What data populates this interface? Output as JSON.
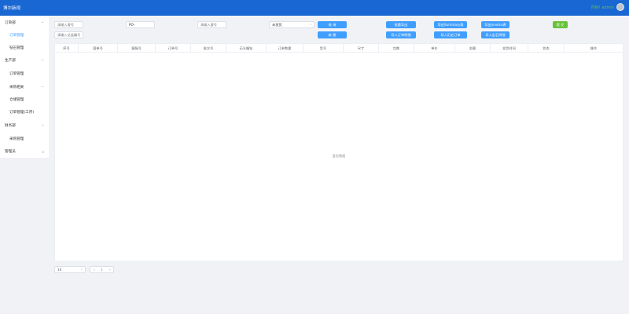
{
  "header": {
    "brand": "博尔新视",
    "user_name": "你好! admin"
  },
  "sidebar": {
    "items": [
      {
        "label": "订单部",
        "chevron": "^"
      },
      {
        "label": "订单管理"
      },
      {
        "label": "钻石管理"
      },
      {
        "label": "生产部",
        "chevron": "^"
      },
      {
        "label": "订单管理"
      },
      {
        "label": "采购相关",
        "chevron": "^"
      },
      {
        "label": "仓储管理"
      },
      {
        "label": "订单管理(工序)"
      },
      {
        "label": "财务部",
        "chevron": "^"
      },
      {
        "label": "采购管理"
      },
      {
        "label": "管理员",
        "chevron": "v"
      }
    ]
  },
  "filters": {
    "input1_placeholder": "请输入客号",
    "input2_placeholder": "请输入总监编号",
    "po_value": "PO-",
    "input3_placeholder": "请输入客号",
    "select_value": "未发货",
    "select_arrow": "v"
  },
  "buttons": {
    "query": "查 询",
    "new": "新 建",
    "export": "批量导出",
    "import_order_detail": "导入订单明细",
    "export_summary": "导出Summary表",
    "import_history": "导入历史订单",
    "export_invoice": "导出invoice表",
    "import_sample": "导入出石明细",
    "submit": "提 交"
  },
  "table": {
    "columns": [
      "序号",
      "国单号",
      "客服号",
      "订单号",
      "批次号",
      "石头编钻",
      "订单数量",
      "型号",
      "尺寸",
      "包数",
      "单价",
      "金额",
      "发货时间",
      "状态",
      "操作"
    ],
    "empty_text": "暂无数据"
  },
  "pagination": {
    "page_size": "10",
    "prev": "<",
    "current_page": "1",
    "next": ">"
  }
}
